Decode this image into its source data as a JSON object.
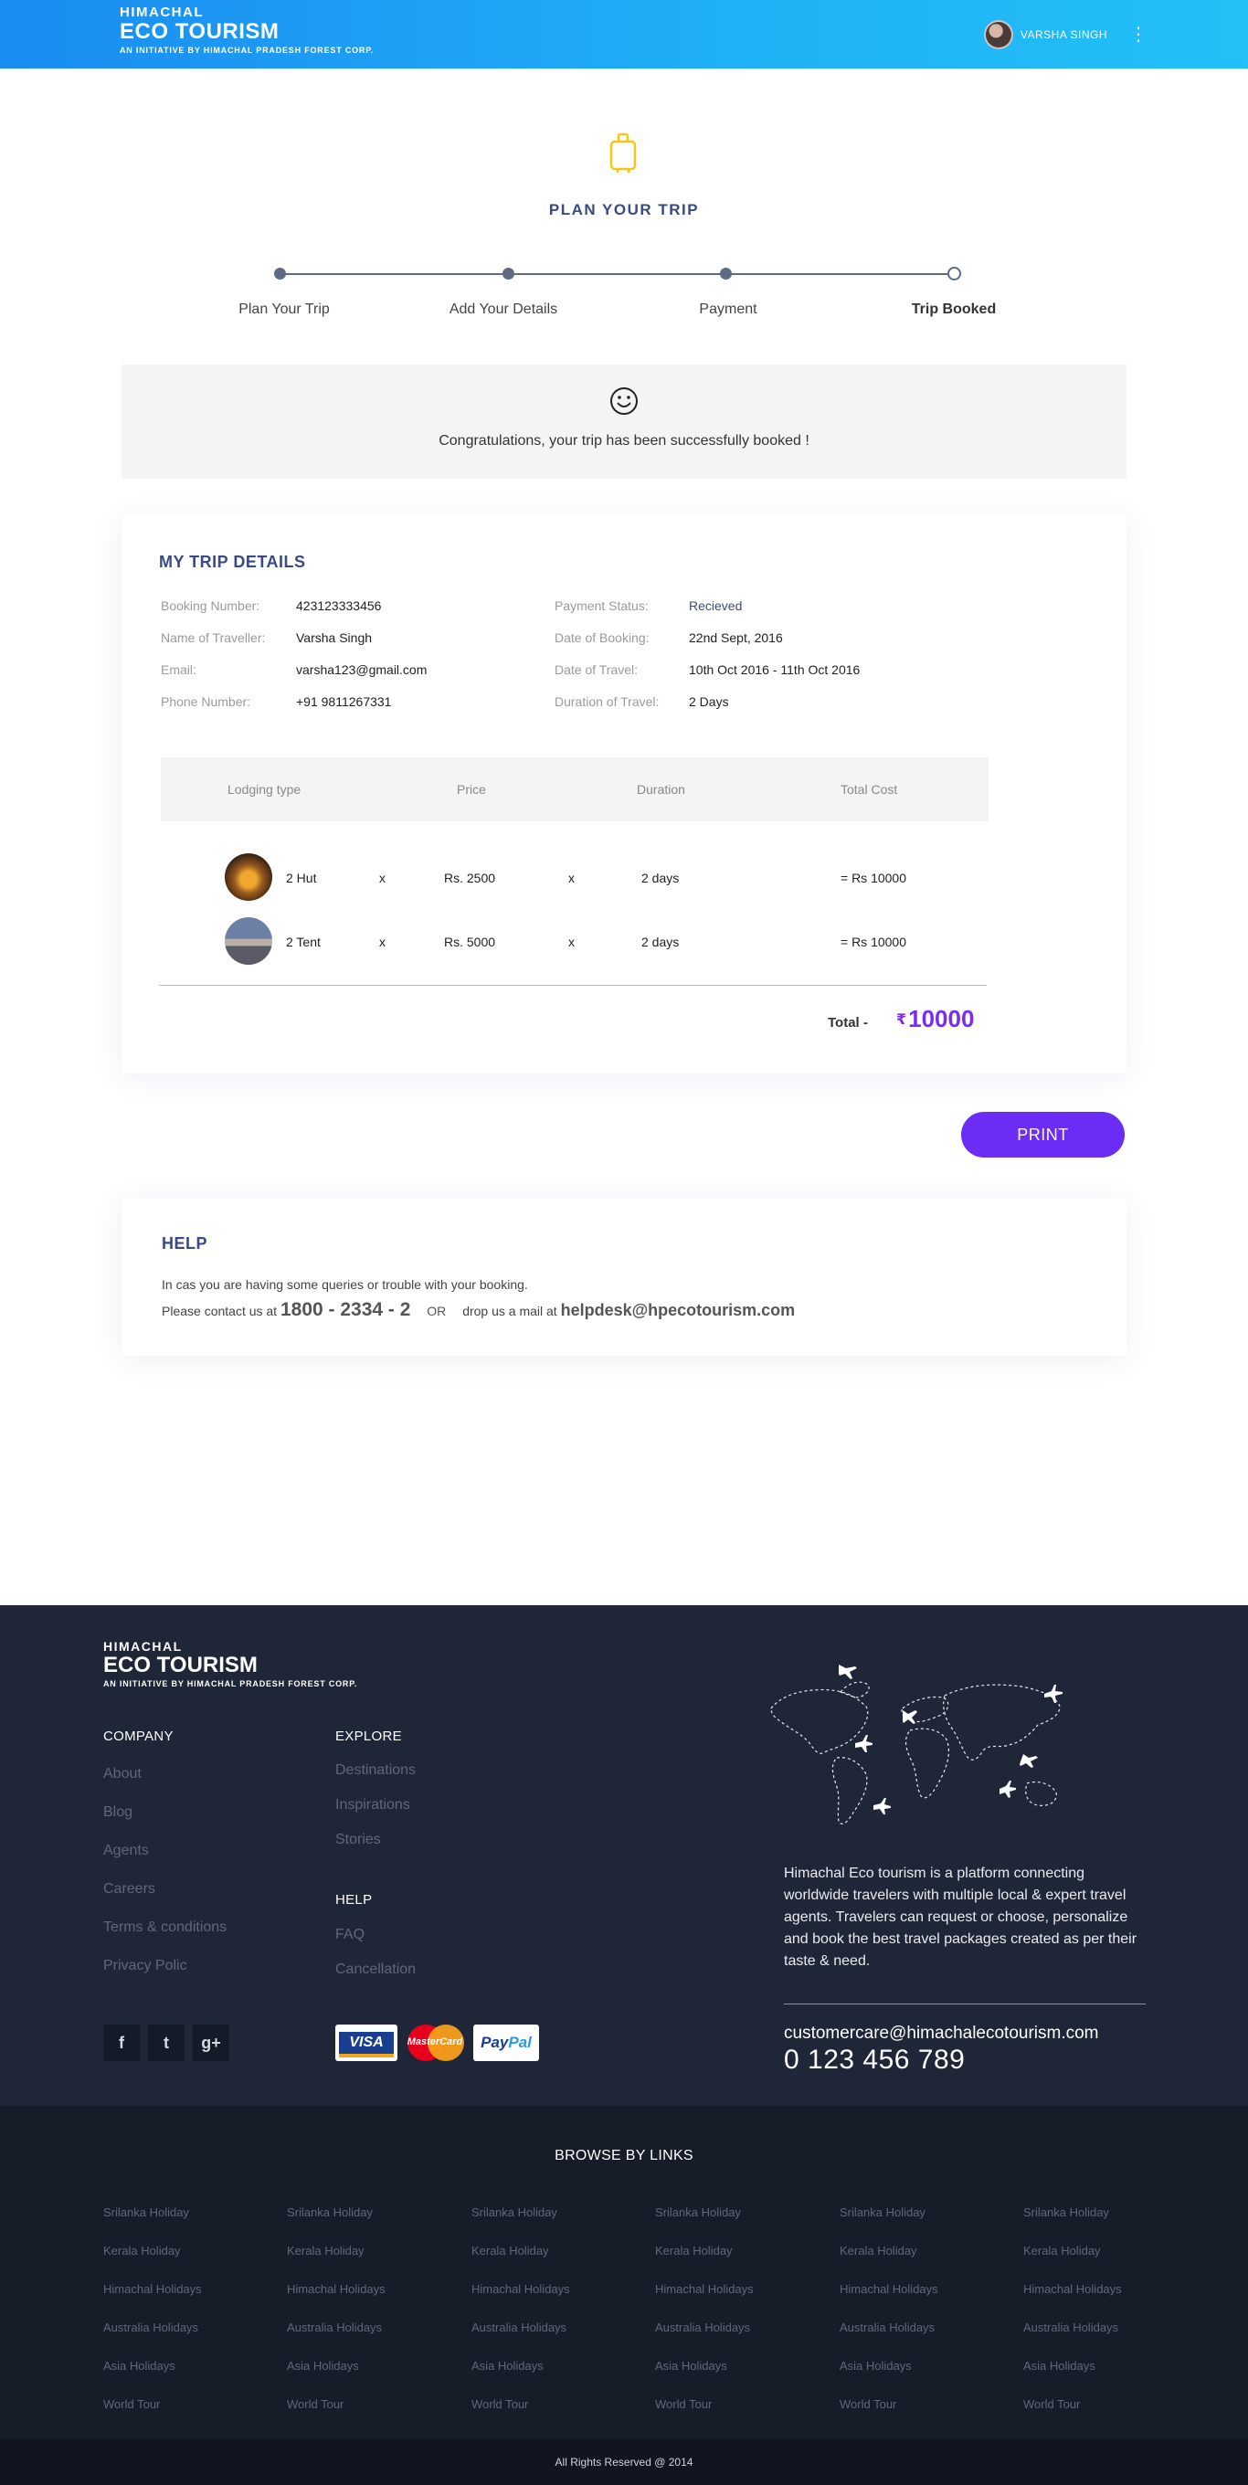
{
  "header": {
    "brand_top": "HIMACHAL",
    "brand_main": "ECO TOURISM",
    "brand_sub": "AN INITIATIVE BY HIMACHAL PRADESH FOREST CORP.",
    "user_name": "VARSHA SINGH",
    "menu_icon": "kebab-menu-icon"
  },
  "plan": {
    "icon": "luggage-icon",
    "title": "PLAN YOUR TRIP",
    "steps": [
      "Plan Your Trip",
      "Add Your Details",
      "Payment",
      "Trip Booked"
    ],
    "active_step": 3,
    "accent_color": "#f5c518"
  },
  "congrats": {
    "icon": "smiley-icon",
    "text": "Congratulations, your trip has been successfully booked !"
  },
  "trip": {
    "title": "MY TRIP DETAILS",
    "left": [
      {
        "label": "Booking Number:",
        "value": "423123333456"
      },
      {
        "label": "Name of Traveller:",
        "value": "Varsha Singh"
      },
      {
        "label": "Email:",
        "value": "varsha123@gmail.com"
      },
      {
        "label": "Phone Number:",
        "value": "+91 9811267331"
      }
    ],
    "right": [
      {
        "label": "Payment Status:",
        "value": "Recieved"
      },
      {
        "label": "Date of Booking:",
        "value": "22nd Sept, 2016"
      },
      {
        "label": "Date of Travel:",
        "value": "10th Oct 2016 - 11th Oct 2016"
      },
      {
        "label": "Duration of Travel:",
        "value": "2 Days"
      }
    ],
    "columns": [
      "Lodging type",
      "Price",
      "Duration",
      "Total Cost"
    ],
    "rows": [
      {
        "type": "2 Hut",
        "x1": "x",
        "price": "Rs. 2500",
        "x2": "x",
        "duration": "2 days",
        "total": "= Rs 10000"
      },
      {
        "type": "2 Tent",
        "x1": "x",
        "price": "Rs. 5000",
        "x2": "x",
        "duration": "2 days",
        "total": "= Rs 10000"
      }
    ],
    "total_label": "Total -",
    "currency": "₹",
    "total_value": "10000",
    "total_color": "#7b2cf2"
  },
  "print_label": "PRINT",
  "help": {
    "title": "HELP",
    "line1": "In cas you are having some queries or trouble with your booking.",
    "contact_prefix": "Please contact us at",
    "phone": "1800 - 2334 - 2",
    "or": "OR",
    "mail_prefix": "drop us a mail at",
    "email": "helpdesk@hpecotourism.com"
  },
  "footer": {
    "brand_top": "HIMACHAL",
    "brand_main": "ECO TOURISM",
    "brand_sub": "AN INITIATIVE BY HIMACHAL PRADESH FOREST CORP.",
    "company_head": "COMPANY",
    "company_links": [
      "About",
      "Blog",
      "Agents",
      "Careers",
      "Terms & conditions",
      "Privacy Polic"
    ],
    "explore_head": "EXPLORE",
    "explore_links": [
      "Destinations",
      "Inspirations",
      "Stories"
    ],
    "help_head": "HELP",
    "help_links": [
      "FAQ",
      "Cancellation"
    ],
    "social": [
      "facebook-icon",
      "twitter-icon",
      "google-plus-icon"
    ],
    "social_glyphs": [
      "f",
      "t",
      "g+"
    ],
    "payments": {
      "visa": "VISA",
      "mastercard": "MasterCard",
      "paypal_a": "Pay",
      "paypal_b": "Pal"
    },
    "description": "Himachal Eco tourism is a platform connecting worldwide travelers with multiple local & expert travel agents. Travelers can request or choose, personalize and book the best travel packages created as per their taste & need.",
    "email": "customercare@himachalecotourism.com",
    "phone": "0 123 456 789"
  },
  "browse": {
    "title": "BROWSE BY LINKS",
    "columns": 6,
    "links": [
      "Srilanka Holiday",
      "Kerala Holiday",
      "Himachal Holidays",
      "Australia Holidays",
      "Asia Holidays",
      "World Tour"
    ]
  },
  "copyright": "All Rights Reserved @ 2014"
}
